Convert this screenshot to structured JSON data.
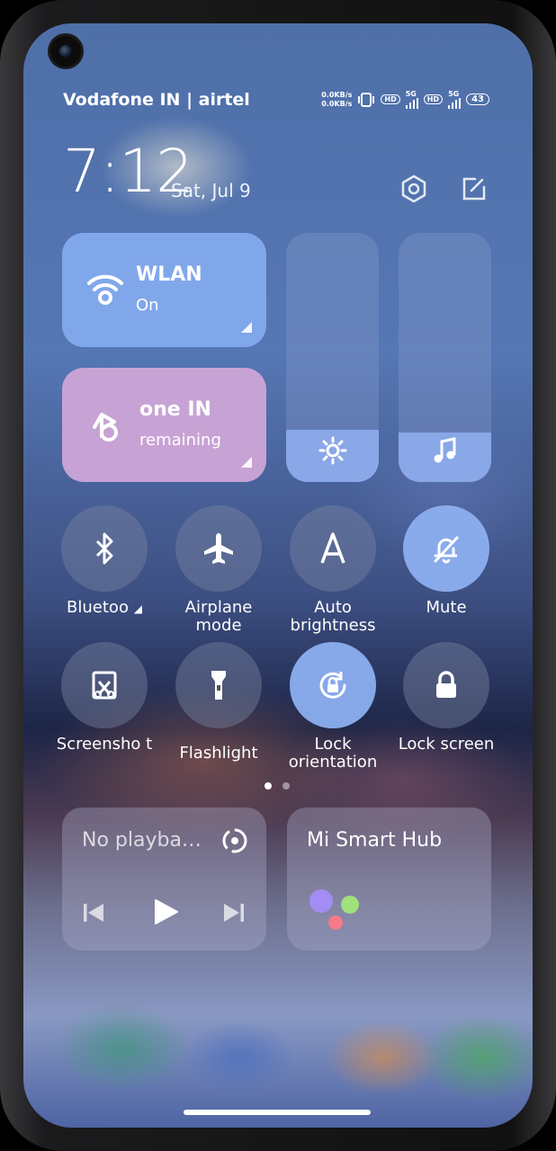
{
  "status_bar": {
    "carrier": "Vodafone IN | airtel",
    "speed_up": "0.0KB/s",
    "speed_down": "0.0KB/s",
    "hd1": "HD",
    "net1": "5G",
    "hd2": "HD",
    "net2": "5G",
    "battery": "43"
  },
  "header": {
    "time": "7:12",
    "date": "Sat, Jul 9"
  },
  "tiles": {
    "wlan": {
      "title": "WLAN",
      "subtitle": "On"
    },
    "mobile_data": {
      "title": "one IN",
      "subtitle": "remaining"
    }
  },
  "sliders": {
    "brightness_level": 0.21,
    "volume_level": 0.2
  },
  "toggles": [
    {
      "label": "Bluetoo",
      "active": false,
      "icon": "bluetooth-icon"
    },
    {
      "label": "Airplane mode",
      "active": false,
      "icon": "airplane-icon"
    },
    {
      "label": "Auto brightness",
      "active": false,
      "icon": "auto-brightness-icon"
    },
    {
      "label": "Mute",
      "active": true,
      "icon": "bell-off-icon"
    },
    {
      "label": "Screensho t",
      "active": false,
      "icon": "screenshot-icon"
    },
    {
      "label": "Flashlight",
      "active": false,
      "icon": "flashlight-icon"
    },
    {
      "label": "Lock orientation",
      "active": true,
      "icon": "rotation-lock-icon"
    },
    {
      "label": "Lock screen",
      "active": false,
      "icon": "lock-icon"
    }
  ],
  "media": {
    "title": "No playba…"
  },
  "smart_hub": {
    "title": "Mi Smart Hub"
  },
  "colors": {
    "accent": "#8cacee",
    "data_tile": "#cda5d7"
  }
}
